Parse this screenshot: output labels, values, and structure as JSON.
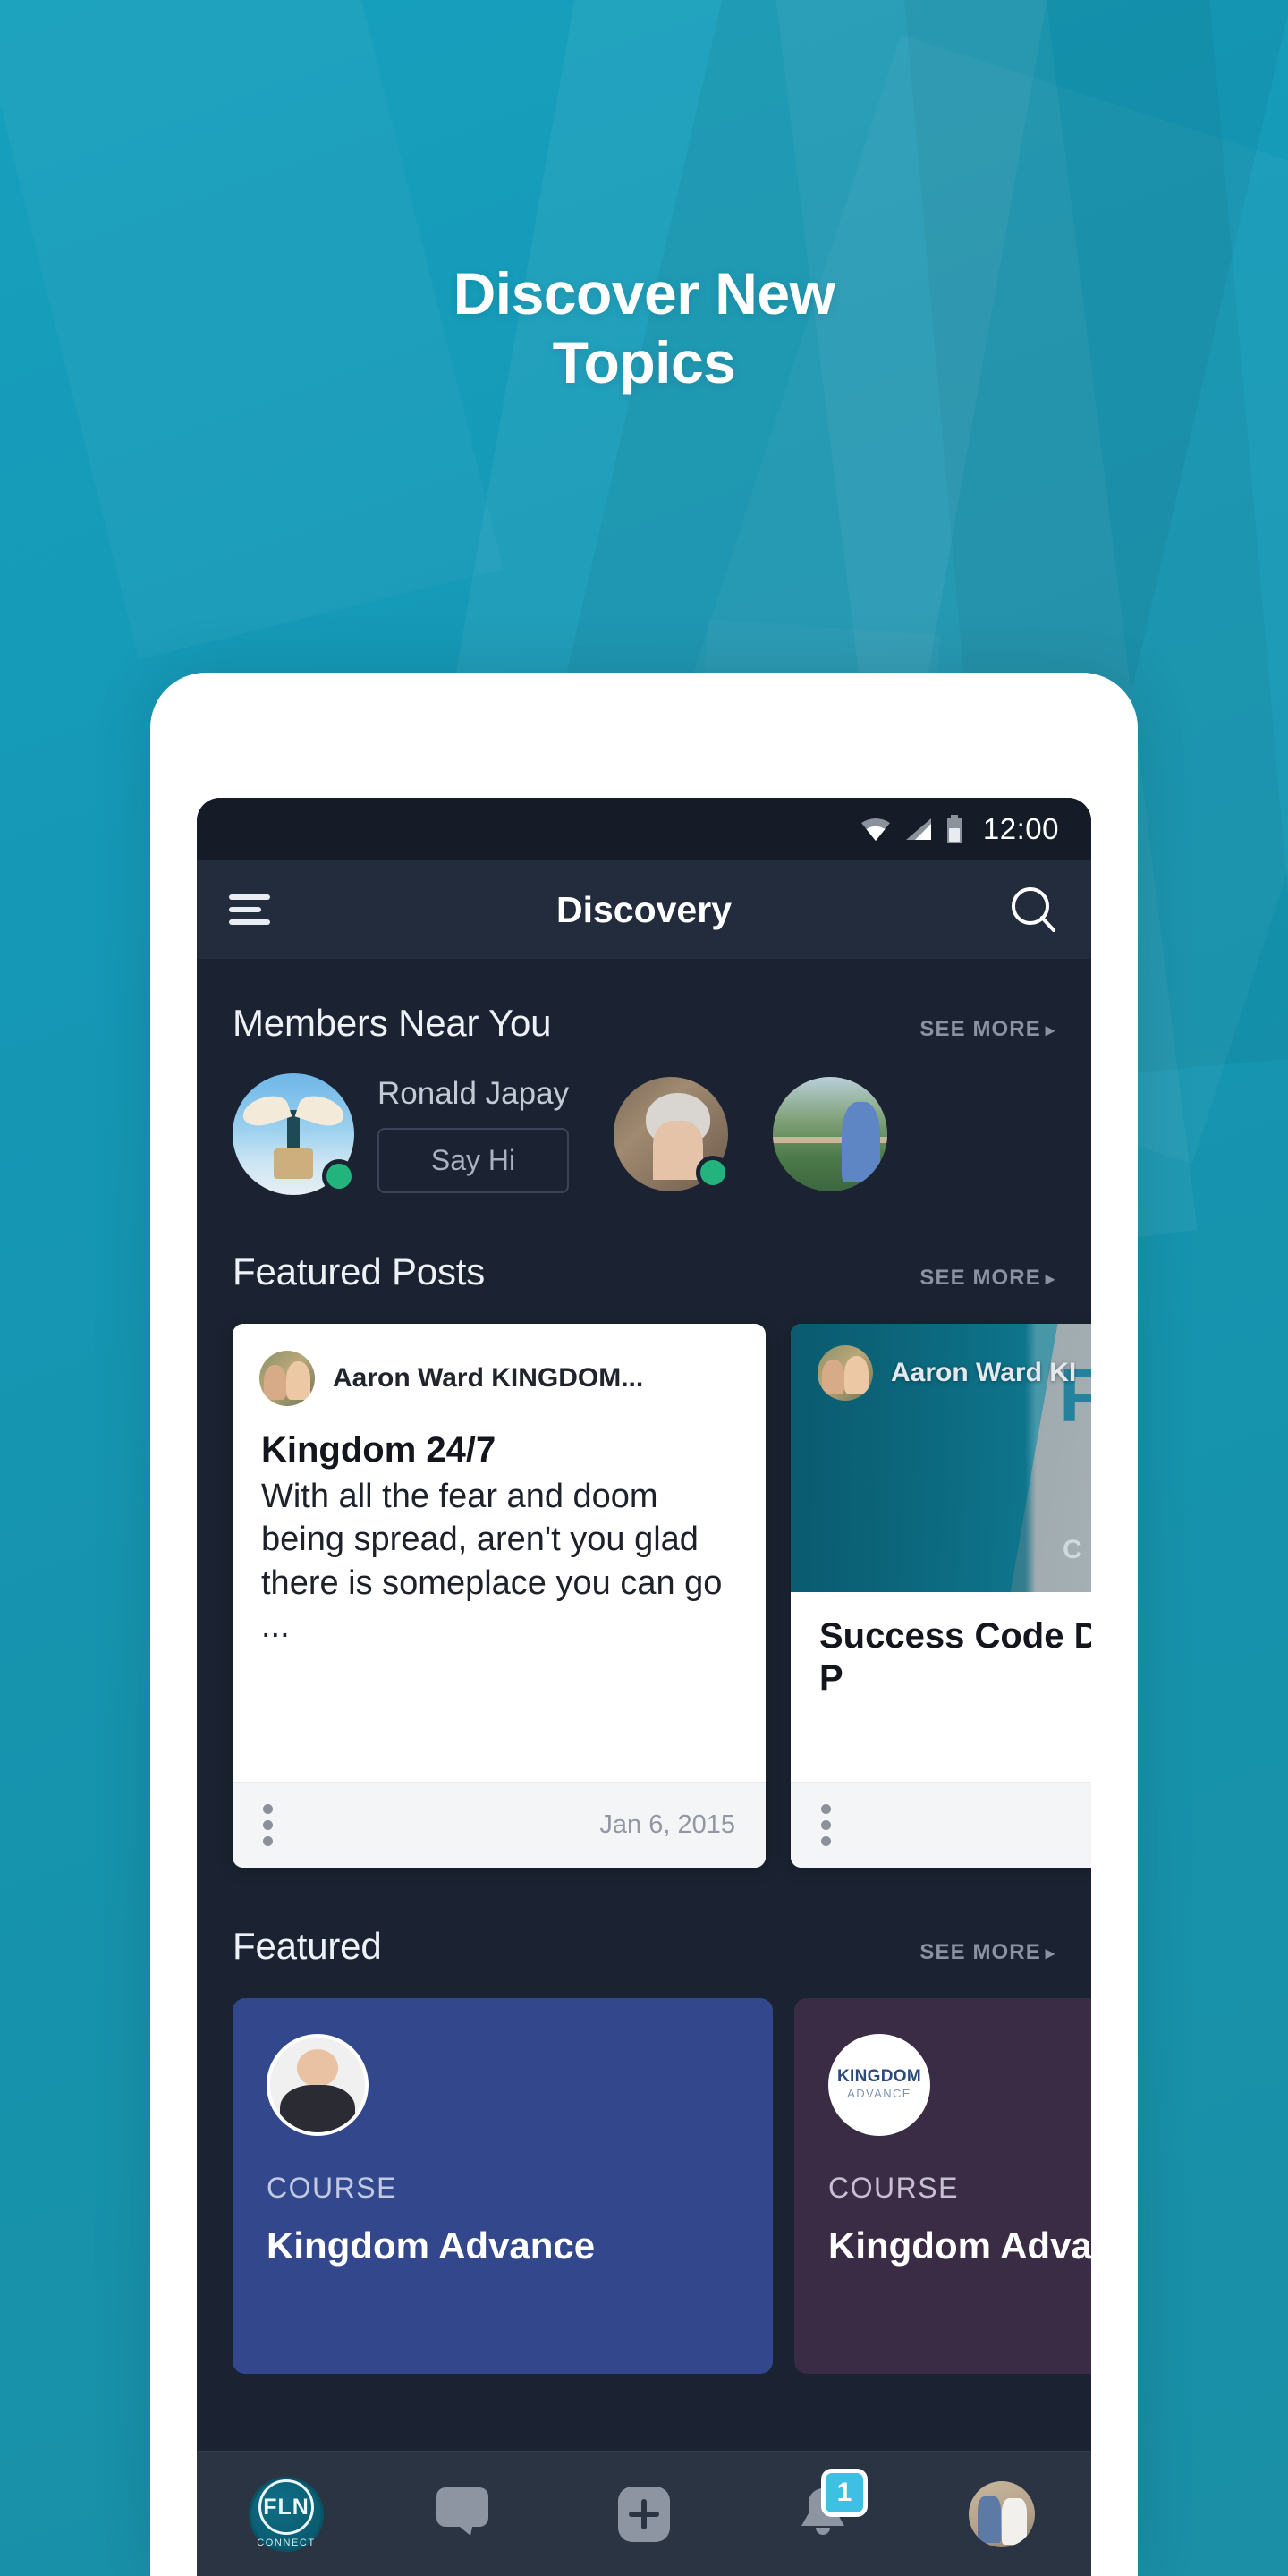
{
  "promo": {
    "headline": "Discover New\nTopics",
    "background_color": "#1596b3"
  },
  "status_bar": {
    "time": "12:00",
    "wifi_icon": "wifi-icon",
    "signal_icon": "signal-icon",
    "battery_icon": "battery-icon"
  },
  "app_bar": {
    "menu_icon": "hamburger-menu-icon",
    "title": "Discovery",
    "search_icon": "search-icon"
  },
  "sections": {
    "members": {
      "title": "Members Near You",
      "see_more": "SEE MORE",
      "chevron": "▸",
      "items": [
        {
          "name": "Ronald Japay",
          "action_label": "Say Hi",
          "online": true,
          "art": "art-angel"
        },
        {
          "name": "",
          "action_label": "",
          "online": true,
          "art": "art-lady"
        },
        {
          "name": "",
          "action_label": "",
          "online": false,
          "art": "art-nature"
        }
      ]
    },
    "featured_posts": {
      "title": "Featured Posts",
      "see_more": "SEE MORE",
      "chevron": "▸",
      "items": [
        {
          "author": "Aaron Ward KINGDOM...",
          "title": "Kingdom 24/7",
          "text": "With all the fear and doom being spread, aren't you glad there is someplace you can go ...",
          "date": "Jan 6, 2015",
          "menu_icon": "kebab-menu-icon"
        },
        {
          "author": "Aaron Ward KI",
          "title": "Success Code Declassified P",
          "date": "",
          "media_big_text": "FAI\nLI",
          "media_small_text": "C H U R",
          "menu_icon": "kebab-menu-icon"
        }
      ]
    },
    "featured": {
      "title": "Featured",
      "see_more": "SEE MORE",
      "chevron": "▸",
      "items": [
        {
          "kind": "COURSE",
          "name": "Kingdom Advance",
          "color": "#33478c",
          "art": "art-speaker"
        },
        {
          "kind": "COURSE",
          "name": "Kingdom Adva",
          "color": "#3b2c45",
          "art": "art-kalogo",
          "logo_title": "KINGDOM",
          "logo_sub": "ADVANCE"
        }
      ]
    }
  },
  "bottom_nav": {
    "items": [
      {
        "icon": "fln-connect-logo-icon",
        "label": "FLN",
        "sub_label": "CONNECT",
        "badge": ""
      },
      {
        "icon": "chat-bubble-icon",
        "label": "",
        "badge": ""
      },
      {
        "icon": "plus-icon",
        "label": "",
        "badge": ""
      },
      {
        "icon": "bell-icon",
        "label": "",
        "badge": "1"
      },
      {
        "icon": "profile-avatar-icon",
        "label": "",
        "badge": ""
      }
    ]
  }
}
